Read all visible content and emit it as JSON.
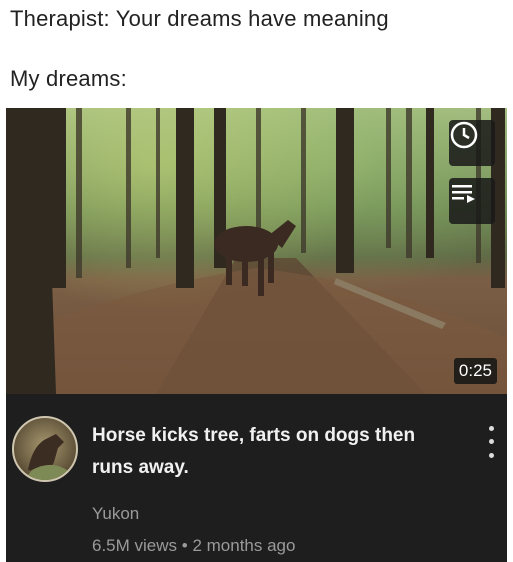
{
  "captions": {
    "line1": "Therapist: Your dreams have meaning",
    "line2": "My dreams:"
  },
  "video": {
    "duration": "0:25",
    "title": "Horse kicks tree, farts on dogs then runs away.",
    "channel": "Yukon",
    "views": "6.5M views",
    "separator": "•",
    "age": "2 months ago"
  },
  "icons": {
    "watch_later": "clock-icon",
    "add_to_queue": "playlist-add-icon",
    "more": "more-vert-icon"
  },
  "colors": {
    "panel": "#1e1e1e",
    "title": "#f1f1f1",
    "secondary": "#9a9a9a"
  }
}
